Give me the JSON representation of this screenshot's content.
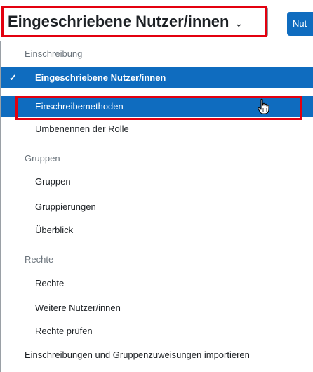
{
  "select": {
    "current_value": "Eingeschriebene Nutzer/innen",
    "chevron": "chevron-down-icon"
  },
  "button": {
    "label": "Nut"
  },
  "dropdown": {
    "groups": [
      {
        "label": "Einschreibung",
        "options": [
          {
            "label": "Eingeschriebene Nutzer/innen",
            "selected": true
          },
          {
            "label": "Einschreibemethoden",
            "hovered": true
          },
          {
            "label": "Umbenennen der Rolle"
          }
        ]
      },
      {
        "label": "Gruppen",
        "options": [
          {
            "label": "Gruppen"
          },
          {
            "label": "Gruppierungen"
          },
          {
            "label": "Überblick"
          }
        ]
      },
      {
        "label": "Rechte",
        "options": [
          {
            "label": "Rechte"
          },
          {
            "label": "Weitere Nutzer/innen"
          },
          {
            "label": "Rechte prüfen"
          }
        ]
      }
    ],
    "ungrouped_option": "Einschreibungen und Gruppenzuweisungen importieren"
  },
  "colors": {
    "accent": "#0f6cbf",
    "highlight": "#e3000f",
    "group_label": "#6a737b"
  },
  "icons": {
    "check": "check-icon",
    "cursor": "hand-pointer-icon"
  }
}
